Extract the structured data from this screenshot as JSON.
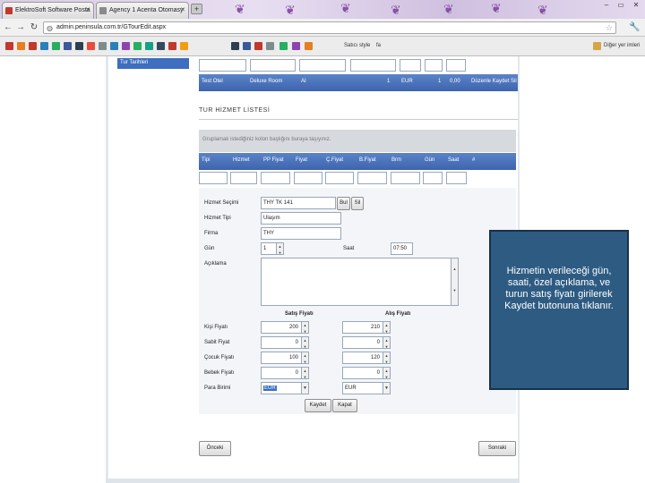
{
  "browser": {
    "tabs": [
      {
        "label": "ElektroSoft Software Posta",
        "favicon_color": "#c0392b"
      },
      {
        "label": "Agency 1 Acenta Otomasy",
        "favicon_color": "#8a8a8a"
      }
    ],
    "url": "admin.peninsula.com.tr/GTourEdit.aspx",
    "bookmarks": {
      "item1": "Satıcı style",
      "item2": "fa",
      "other": "Diğer yer imleri"
    }
  },
  "page": {
    "sidebar_link": "Tur Tarihleri",
    "top_row": {
      "c1": "Test Otel",
      "c2": "Deluxe Room",
      "c3": "AI",
      "c4": "1",
      "c5": "EUR",
      "c6": "1",
      "c7": "0,00",
      "c8": "Düzenle Kaydet Sil"
    },
    "section_title": "TUR HİZMET LİSTESİ",
    "grouping_hint": "Gruplamak istediğiniz kolon başlığını buraya taşıyınız.",
    "headers": [
      "Tipi",
      "Hizmet",
      "PP Fiyat",
      "Fiyat",
      "Ç.Fiyat",
      "B.Fiyat",
      "Brm",
      "Gün",
      "Saat",
      "#"
    ],
    "form": {
      "hizmet_secimi_label": "Hizmet Seçimi",
      "hizmet_secimi_value": "THY TK 141",
      "bul_button": "Bul",
      "sil_button": "Sil",
      "hizmet_tipi_label": "Hizmet Tipi",
      "hizmet_tipi_value": "Ulaşım",
      "firma_label": "Firma",
      "firma_value": "THY",
      "gun_label": "Gün",
      "gun_value": "1",
      "saat_label": "Saat",
      "saat_value": "07:50",
      "aciklama_label": "Açıklama",
      "satis_header": "Satış Fiyatı",
      "alis_header": "Alış Fiyatı",
      "kisi_label": "Kişi Fiyatı",
      "kisi_satis": "200",
      "kisi_alis": "210",
      "sabit_label": "Sabit Fiyat",
      "sabit_satis": "0",
      "sabit_alis": "0",
      "cocuk_label": "Çocuk Fiyatı",
      "cocuk_satis": "100",
      "cocuk_alis": "120",
      "bebek_label": "Bebek Fiyatı",
      "bebek_satis": "0",
      "bebek_alis": "0",
      "para_label": "Para Birimi",
      "para_satis": "EUR",
      "para_alis": "EUR",
      "kaydet_button": "Kaydet",
      "kapat_button": "Kapat"
    },
    "geri_button": "Önceki",
    "ileri_button": "Sonraki"
  },
  "callout": "Hizmetin verileceği gün, saati, özel açıklama, ve turun satış fiyatı girilerek Kaydet butonuna tıklanır."
}
